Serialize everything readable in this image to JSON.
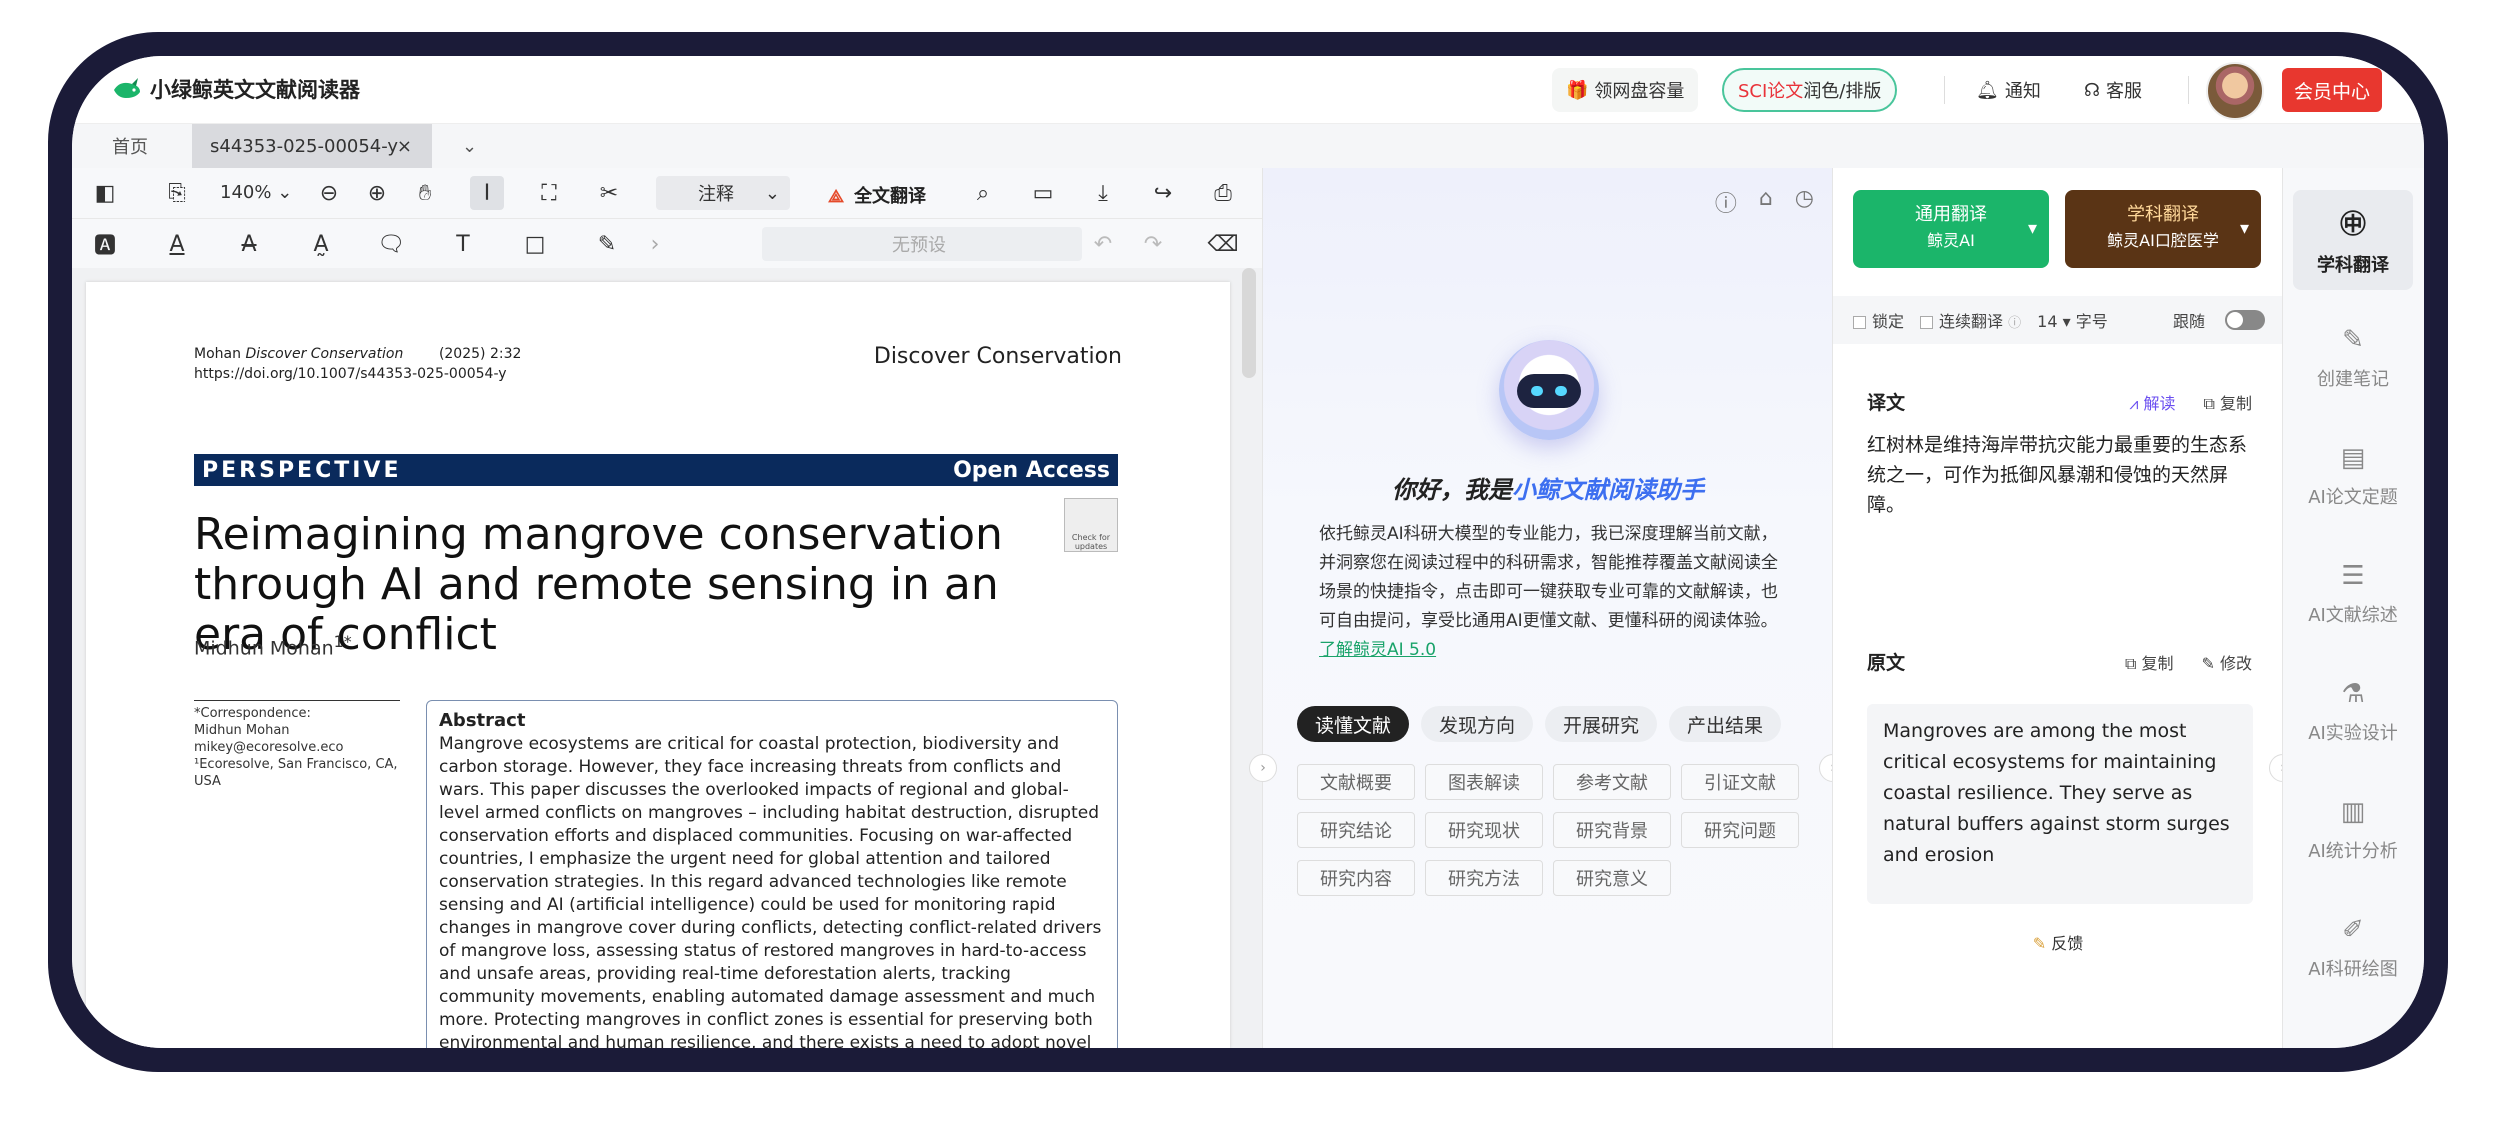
{
  "app": {
    "name": "小绿鲸英文文献阅读器",
    "gift": "领网盘容量",
    "sci_red": "SCI论文",
    "sci_rest": "润色/排版",
    "notify": "通知",
    "service": "客服",
    "vip": "会员中心"
  },
  "tabs": {
    "home": "首页",
    "doc": "s44353-025-00054-y",
    "close": "×",
    "more": "⌄"
  },
  "toolbar": {
    "zoom": "140%",
    "annotate": "注释",
    "full_translate": "全文翻译",
    "preset": "无预设"
  },
  "pdf": {
    "author_line": "Mohan",
    "journal_italic": "Discover Conservation",
    "year_page": "(2025) 2:32",
    "doi": "https://doi.org/10.1007/s44353-025-00054-y",
    "journal": "Discover Conservation",
    "band_left": "PERSPECTIVE",
    "band_right": "Open Access",
    "title": "Reimagining mangrove conservation through AI and remote sensing in an era of conflict",
    "check": "Check for updates",
    "author": "Midhun Mohan",
    "author_sup": "1*",
    "corr1": "*Correspondence:",
    "corr2": "Midhun Mohan",
    "corr3": "mikey@ecoresolve.eco",
    "corr4": "¹Ecoresolve, San Francisco, CA, USA",
    "abstract_title": "Abstract",
    "abstract": "Mangrove ecosystems are critical for coastal protection, biodiversity and carbon storage. However, they face increasing threats from conflicts and wars. This paper discusses the overlooked impacts of regional and global-level armed conflicts on mangroves – including habitat destruction, disrupted conservation efforts and displaced communities. Focusing on war-affected countries, I emphasize the urgent need for global attention and tailored conservation strategies. In this regard advanced technologies like remote sensing and AI (artificial intelligence) could be used for monitoring rapid changes in mangrove cover during conflicts, detecting conflict-related drivers of mangrove loss, assessing status of restored mangroves in hard-to-access and unsafe areas, providing real-time deforestation alerts, tracking community movements, enabling automated damage assessment and much more. Protecting mangroves in conflict zones is essential for preserving both environmental and human resilience, and there exists a need to adopt novel technology-based conservation approaches."
  },
  "assistant": {
    "hello_prefix": "你好，我是",
    "hello_name": "小鲸文献阅读助手",
    "intro": "依托鲸灵AI科研大模型的专业能力，我已深度理解当前文献，并洞察您在阅读过程中的科研需求，智能推荐覆盖文献阅读全场景的快捷指令，点击即可一键获取专业可靠的文献解读，也可自由提问，享受比通用AI更懂文献、更懂科研的阅读体验。",
    "link": "了解鲸灵AI 5.0",
    "pills": [
      "读懂文献",
      "发现方向",
      "开展研究",
      "产出结果"
    ],
    "grid": [
      "文献概要",
      "图表解读",
      "参考文献",
      "引证文献",
      "研究结论",
      "研究现状",
      "研究背景",
      "研究问题",
      "研究内容",
      "研究方法",
      "研究意义"
    ]
  },
  "translate": {
    "general": "通用翻译",
    "general_sub": "鲸灵AI",
    "subject": "学科翻译",
    "subject_sub": "鲸灵AI口腔医学",
    "lock": "锁定",
    "continuous": "连续翻译",
    "size": "14",
    "size_label": "字号",
    "follow": "跟随",
    "trans_title": "译文",
    "interpret": "解读",
    "copy": "复制",
    "trans_text": "红树林是维持海岸带抗灾能力最重要的生态系统之一，可作为抵御风暴潮和侵蚀的天然屏障。",
    "orig_title": "原文",
    "edit": "修改",
    "orig_text": "Mangroves are among the most critical ecosystems for maintaining coastal resilience. They serve as natural buffers against storm surges and erosion",
    "feedback": "反馈"
  },
  "sidebar": [
    "学科翻译",
    "创建笔记",
    "AI论文定题",
    "AI文献综述",
    "AI实验设计",
    "AI统计分析",
    "AI科研绘图"
  ]
}
